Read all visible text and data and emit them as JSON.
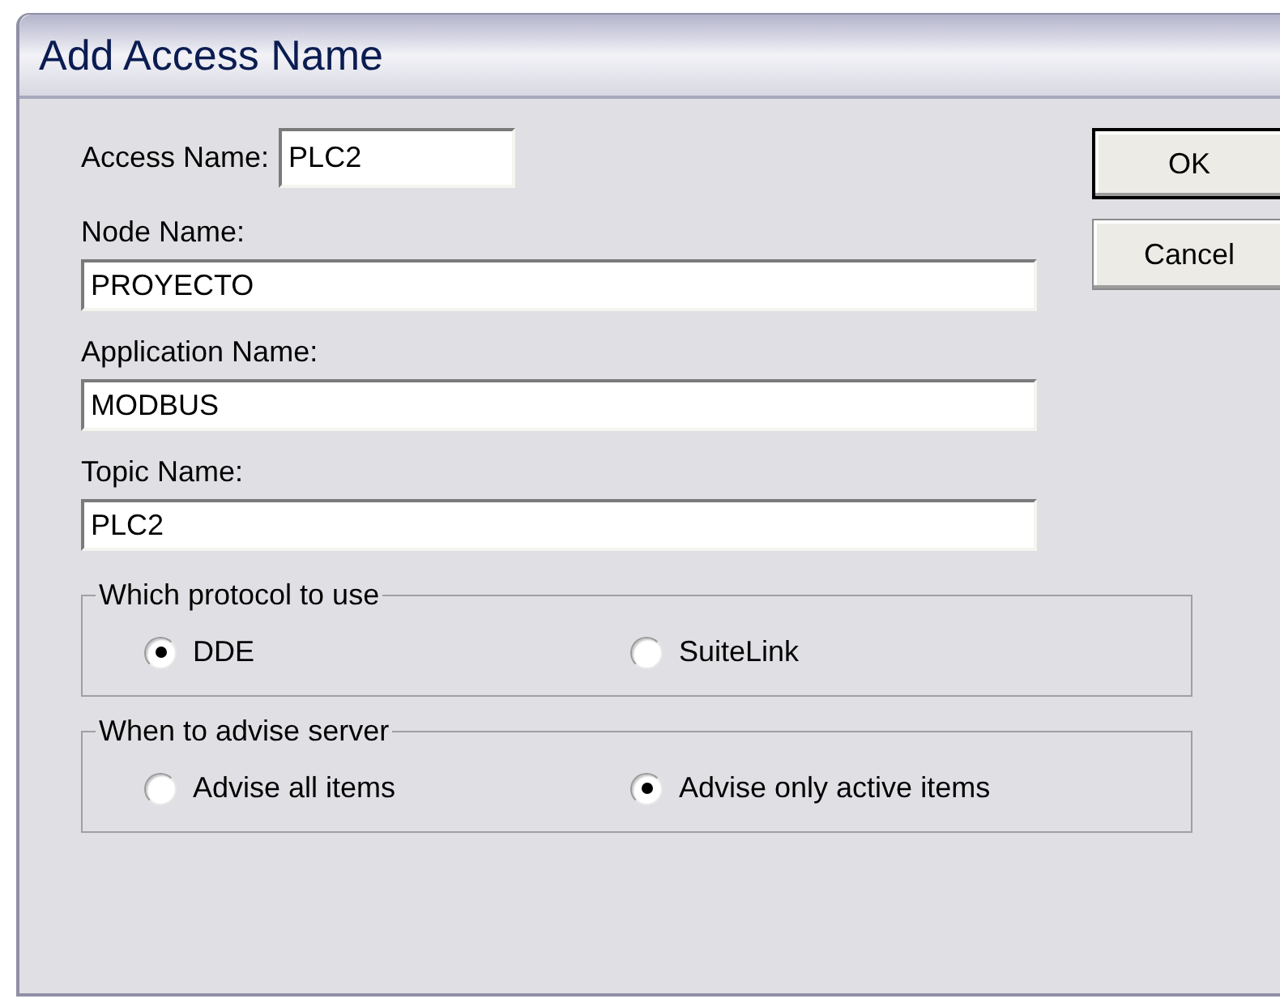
{
  "window": {
    "title": "Add Access Name"
  },
  "access_name": {
    "label": "Access Name:",
    "value": "PLC2"
  },
  "fields": [
    {
      "label": "Node Name:",
      "value": "PROYECTO"
    },
    {
      "label": "Application Name:",
      "value": "MODBUS"
    },
    {
      "label": "Topic Name:",
      "value": "PLC2"
    }
  ],
  "groups": [
    {
      "title": "Which protocol to use",
      "options": [
        {
          "label": "DDE",
          "selected": true
        },
        {
          "label": "SuiteLink",
          "selected": false
        }
      ]
    },
    {
      "title": "When to advise server",
      "options": [
        {
          "label": "Advise all items",
          "selected": false
        },
        {
          "label": "Advise only active items",
          "selected": true
        }
      ]
    }
  ],
  "buttons": [
    {
      "label": "OK",
      "default": true
    },
    {
      "label": "Cancel",
      "default": false
    }
  ]
}
